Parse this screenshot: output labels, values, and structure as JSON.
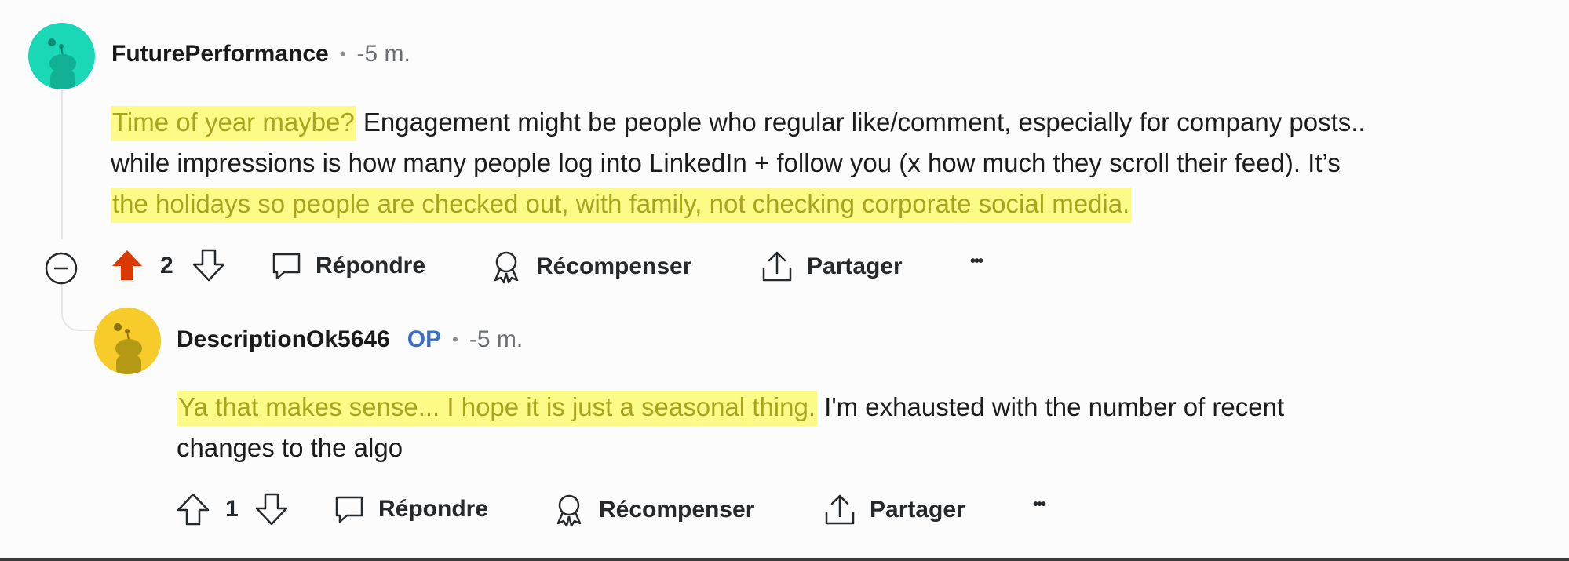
{
  "comments": [
    {
      "username": "FuturePerformance",
      "separator": "•",
      "time": "-5 m.",
      "lines": [
        [
          {
            "text": "Time of year maybe?",
            "hl": true
          },
          {
            "text": " Engagement might be people who regular like/comment, especially for company posts..",
            "hl": false
          }
        ],
        [
          {
            "text": "while impressions is how many people log into LinkedIn + follow you (x how much they scroll their feed). It’s",
            "hl": false
          }
        ],
        [
          {
            "text": "the holidays so people are checked out, with family, not checking corporate social media.",
            "hl": true
          }
        ]
      ],
      "votes": "2",
      "upvoted": true,
      "actions": {
        "reply": "Répondre",
        "award": "Récompenser",
        "share": "Partager",
        "more": "•••"
      },
      "avatar_color": "#1ad8b6"
    },
    {
      "username": "DescriptionOk5646",
      "op_badge": "OP",
      "separator": "•",
      "time": "-5 m.",
      "lines": [
        [
          {
            "text": "Ya that makes sense... I hope it is just a seasonal thing.",
            "hl": true
          },
          {
            "text": " I'm exhausted with the number of recent",
            "hl": false
          }
        ],
        [
          {
            "text": "changes to the algo",
            "hl": false
          }
        ]
      ],
      "votes": "1",
      "upvoted": false,
      "actions": {
        "reply": "Répondre",
        "award": "Récompenser",
        "share": "Partager",
        "more": "•••"
      },
      "avatar_color": "#f7cb2a"
    }
  ],
  "colors": {
    "upvote_active": "#d93a00",
    "highlight_bg": "#fdfb87",
    "highlight_text": "#a7a41f",
    "op_badge": "#3a6fc4"
  }
}
